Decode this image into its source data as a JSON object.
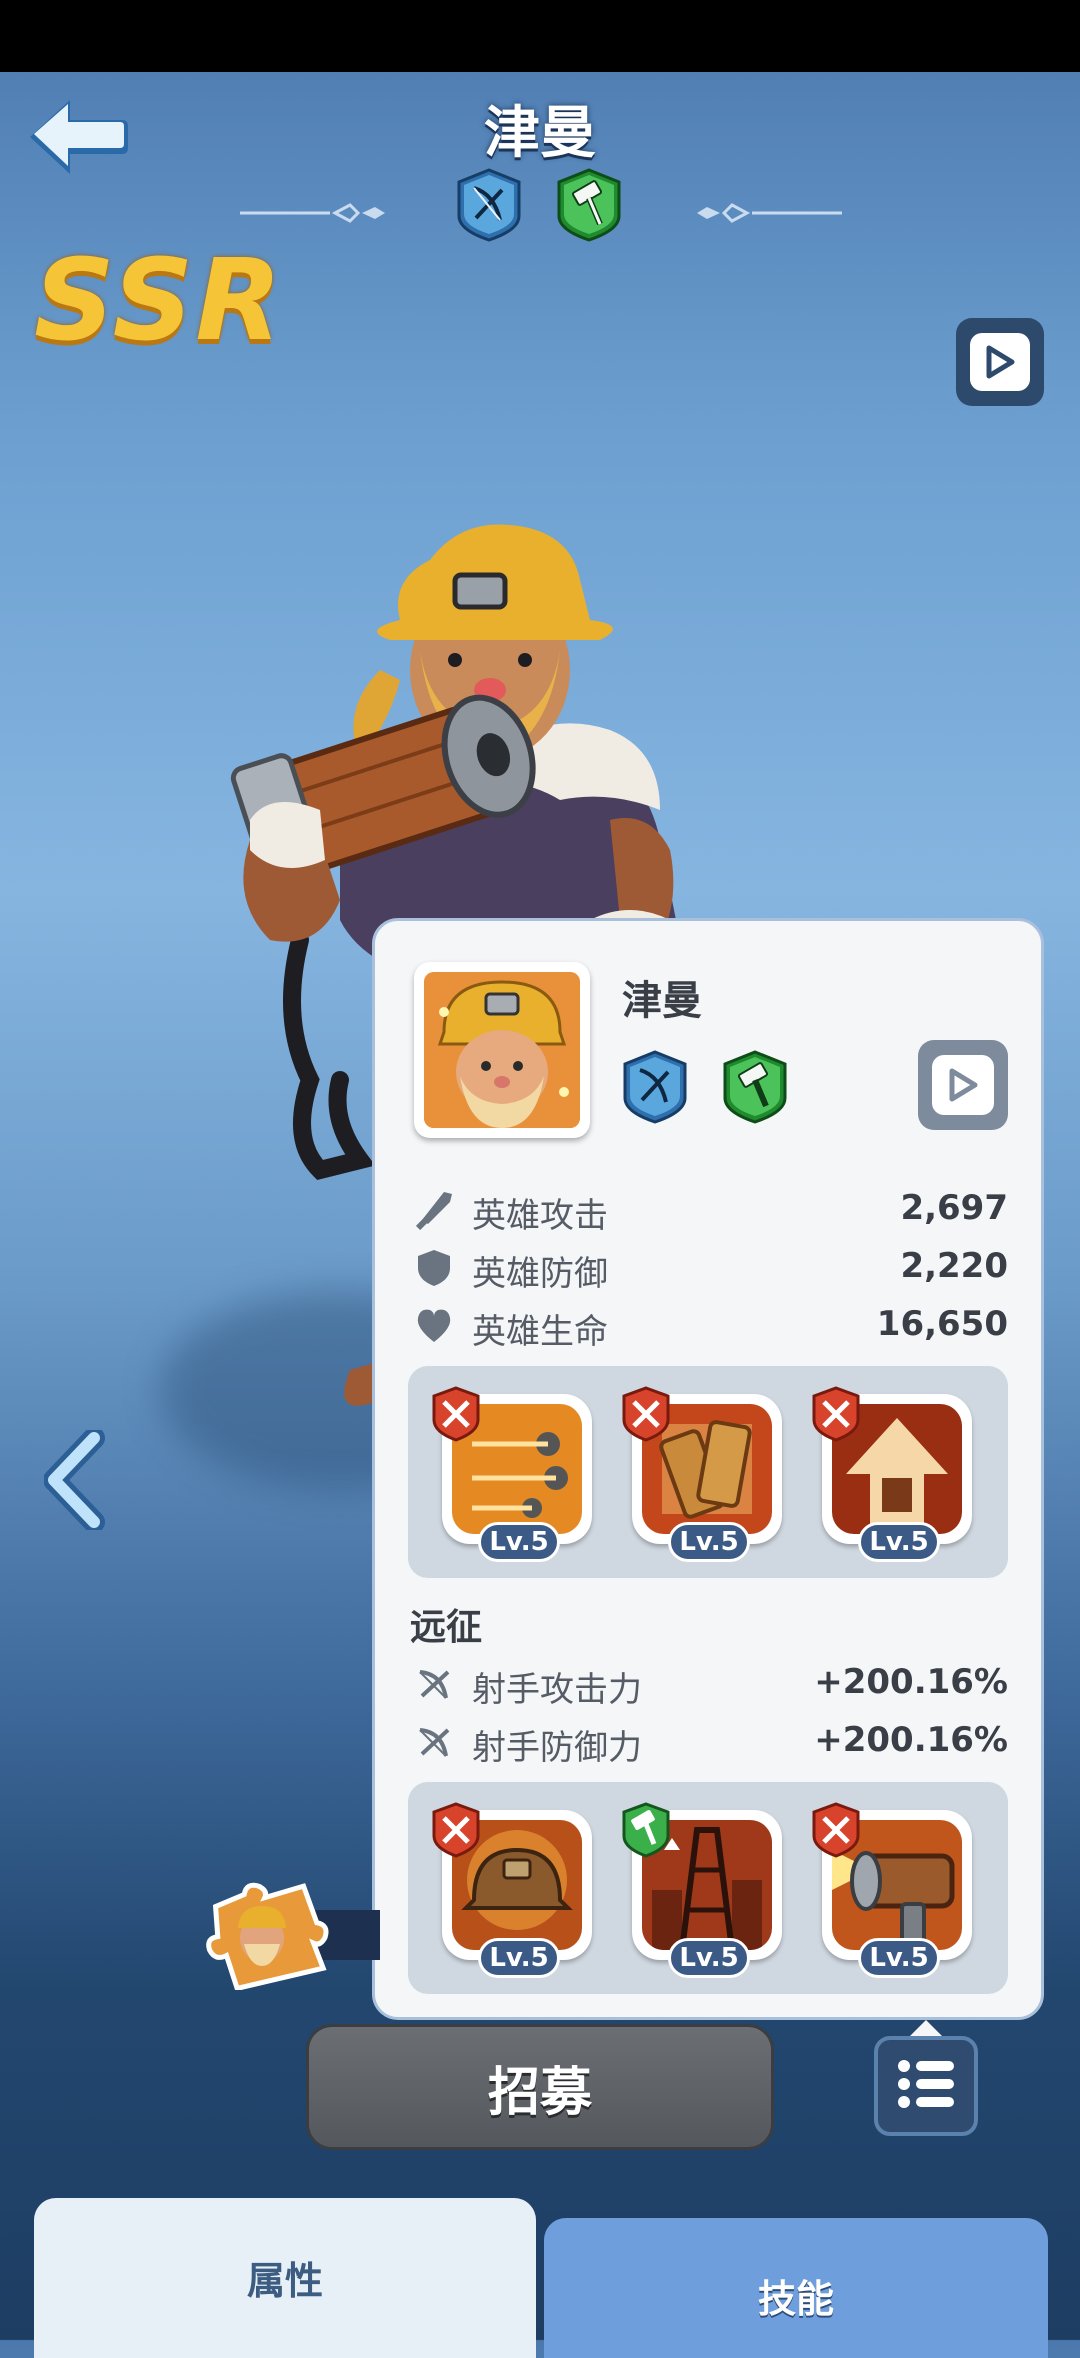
{
  "header": {
    "title": "津曼",
    "rarity": "SSR",
    "class_icons": [
      "crossbow-icon",
      "hammer-icon"
    ]
  },
  "popup": {
    "hero_name": "津曼",
    "class_icons": [
      "crossbow-icon",
      "hammer-icon"
    ],
    "stats": [
      {
        "icon": "sword-icon",
        "label": "英雄攻击",
        "value": "2,697"
      },
      {
        "icon": "shield-icon",
        "label": "英雄防御",
        "value": "2,220"
      },
      {
        "icon": "heart-icon",
        "label": "英雄生命",
        "value": "16,650"
      }
    ],
    "skills": [
      {
        "name": "skill-bolts",
        "badge": "crossed-swords-icon",
        "level": "Lv.5"
      },
      {
        "name": "skill-plank",
        "badge": "crossed-swords-icon",
        "level": "Lv.5"
      },
      {
        "name": "skill-fist-arrow",
        "badge": "crossed-swords-icon",
        "level": "Lv.5"
      }
    ],
    "expedition": {
      "title": "远征",
      "stats": [
        {
          "icon": "crossbow-icon",
          "label": "射手攻击力",
          "value": "+200.16%"
        },
        {
          "icon": "crossbow-icon",
          "label": "射手防御力",
          "value": "+200.16%"
        }
      ]
    },
    "expedition_skills": [
      {
        "name": "skill-helmet",
        "badge": "crossed-swords-icon",
        "level": "Lv.5"
      },
      {
        "name": "skill-derrick",
        "badge": "hammer-icon",
        "level": "Lv.5"
      },
      {
        "name": "skill-cannon",
        "badge": "crossed-swords-icon",
        "level": "Lv.5"
      }
    ]
  },
  "buttons": {
    "recruit": "招募"
  },
  "tabs": [
    {
      "label": "属性",
      "active": true
    },
    {
      "label": "技能",
      "active": false
    }
  ],
  "colors": {
    "rarity_gold": "#f6c437",
    "class_blue": "#3f86c4",
    "class_green": "#3bb04a",
    "badge_red": "#d8432c",
    "level_pill": "#3b5a86"
  }
}
